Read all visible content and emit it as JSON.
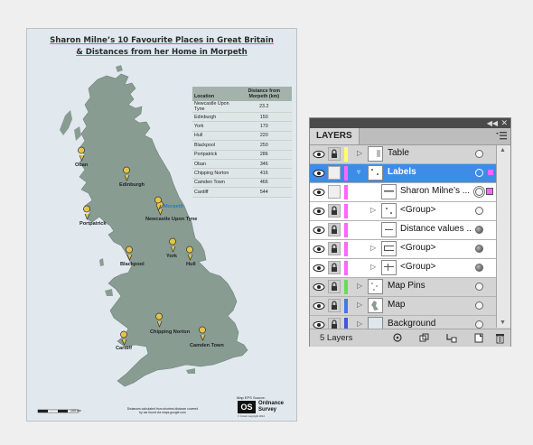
{
  "poster": {
    "title_line1": "Sharon Milne’s 10 Favourite Places in Great Britain",
    "title_line2": "& Distances from her Home in Morpeth",
    "table": {
      "col_location": "Location",
      "col_distance": "Distance from Morpeth (km)",
      "rows": [
        {
          "location": "Newcastle Upon Tyne",
          "distance": "23.2"
        },
        {
          "location": "Edinburgh",
          "distance": "150"
        },
        {
          "location": "York",
          "distance": "170"
        },
        {
          "location": "Hull",
          "distance": "220"
        },
        {
          "location": "Blackpool",
          "distance": "250"
        },
        {
          "location": "Portpatrick",
          "distance": "286"
        },
        {
          "location": "Oban",
          "distance": "346"
        },
        {
          "location": "Chipping Norton",
          "distance": "416"
        },
        {
          "location": "Camden Town",
          "distance": "466"
        },
        {
          "location": "Cardiff",
          "distance": "544"
        }
      ]
    },
    "pins": {
      "oban": "Oban",
      "edinburgh": "Edinburgh",
      "morpeth": "Morpeth",
      "newcastle": "Newcastle Upon Tyne",
      "portpatrick": "Portpatrick",
      "blackpool": "Blackpool",
      "york": "York",
      "hull": "Hull",
      "chipping_norton": "Chipping Norton",
      "cardiff": "Cardiff",
      "camden_town": "Camden Town"
    },
    "scale_label": "100 km",
    "footer_note": "Distances calculated from shortest distance covered by car found via maps.google.com",
    "os_source": "Map EPS Source:",
    "os_brand_line1": "Ordnance",
    "os_brand_line2": "Survey",
    "os_copyright": "© Crown copyright 2012"
  },
  "layers_panel": {
    "tab_label": "LAYERS",
    "layers": [
      {
        "name": "Table",
        "color": "#ffff66",
        "kind": "top"
      },
      {
        "name": "Labels",
        "color": "#ff66ff",
        "kind": "selected"
      },
      {
        "name": "Sharon Milne’s ...",
        "color": "#ff66ff",
        "kind": "sub"
      },
      {
        "name": "<Group>",
        "color": "#ff66ff",
        "kind": "sub"
      },
      {
        "name": "Distance values ...",
        "color": "#ff66ff",
        "kind": "sub"
      },
      {
        "name": "<Group>",
        "color": "#ff66ff",
        "kind": "sub"
      },
      {
        "name": "<Group>",
        "color": "#ff66ff",
        "kind": "sub"
      },
      {
        "name": "Map Pins",
        "color": "#66dd55",
        "kind": "top"
      },
      {
        "name": "Map",
        "color": "#4477ee",
        "kind": "top"
      },
      {
        "name": "Background",
        "color": "#4455dd",
        "kind": "top"
      }
    ],
    "layer_count": "5 Layers"
  },
  "colors": {
    "land": "#889c92",
    "pin": "#e4c44a",
    "selection": "#3d8de8"
  }
}
